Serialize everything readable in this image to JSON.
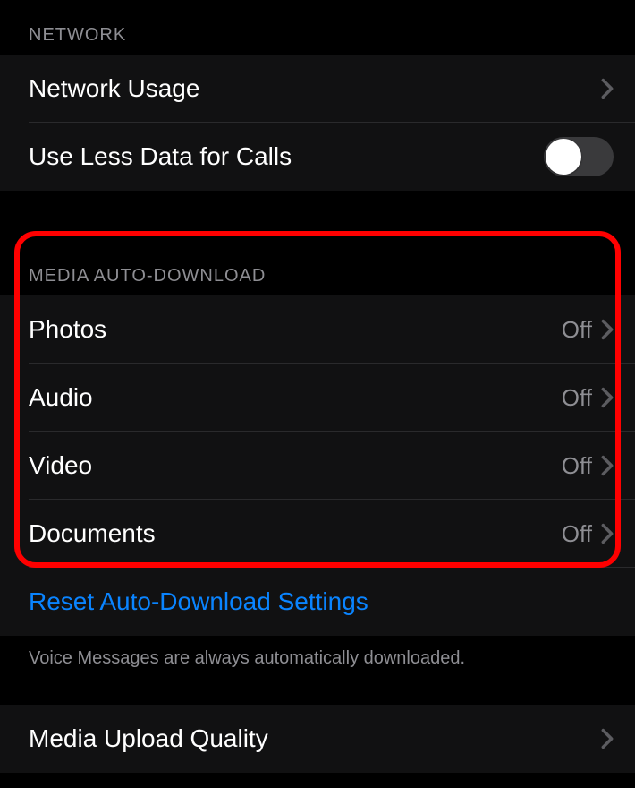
{
  "network": {
    "header": "NETWORK",
    "usage_label": "Network Usage",
    "less_data_label": "Use Less Data for Calls",
    "less_data_on": false
  },
  "media_auto_download": {
    "header": "MEDIA AUTO-DOWNLOAD",
    "items": [
      {
        "label": "Photos",
        "value": "Off"
      },
      {
        "label": "Audio",
        "value": "Off"
      },
      {
        "label": "Video",
        "value": "Off"
      },
      {
        "label": "Documents",
        "value": "Off"
      }
    ],
    "reset_label": "Reset Auto-Download Settings",
    "footer": "Voice Messages are always automatically downloaded."
  },
  "media_upload": {
    "label": "Media Upload Quality"
  }
}
